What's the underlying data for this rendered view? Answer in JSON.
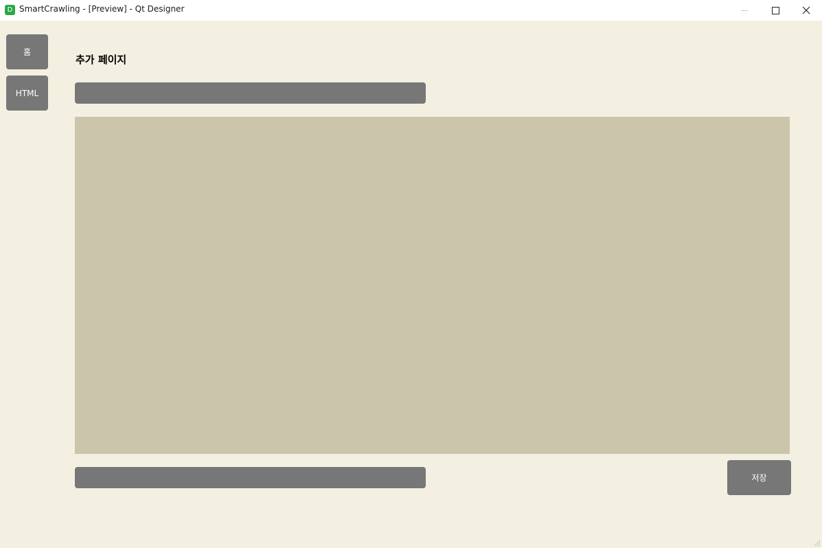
{
  "window": {
    "app_icon_letter": "D",
    "title": "SmartCrawling - [Preview] - Qt Designer"
  },
  "sidebar": {
    "items": [
      {
        "label": "홈"
      },
      {
        "label": "HTML"
      }
    ]
  },
  "main": {
    "title": "추가 페이지",
    "top_input": {
      "value": "",
      "placeholder": ""
    },
    "text_area": {
      "value": ""
    },
    "bottom_input": {
      "value": "",
      "placeholder": ""
    },
    "save_label": "저장"
  },
  "colors": {
    "background": "#f4f0e1",
    "button": "#777777",
    "text_area": "#cbc5ac",
    "app_icon": "#2aa845"
  }
}
